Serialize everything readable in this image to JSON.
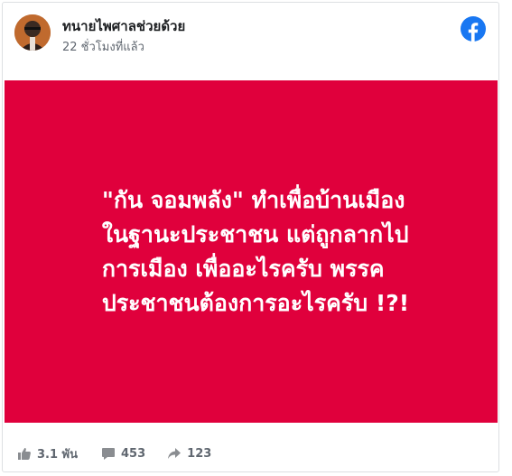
{
  "post": {
    "author": "ทนายไพศาลช่วยด้วย",
    "timestamp": "22 ชั่วโมงที่แล้ว",
    "image_text": {
      "line1": "\"กัน จอมพลัง\" ทำเพื่อบ้านเมือง",
      "line2": "ในฐานะประชาชน แต่ถูกลากไป",
      "line3": "การเมือง เพื่ออะไรครับ พรรค",
      "line4": "ประชาชนต้องการอะไรครับ !?!"
    },
    "image_bg_color": "#e0003c"
  },
  "stats": {
    "likes": "3.1 พัน",
    "comments": "453",
    "shares": "123"
  },
  "colors": {
    "facebook_blue": "#1877f2",
    "meta_gray": "#606770"
  },
  "icons": {
    "brand": "facebook-logo-icon",
    "like": "thumbs-up-icon",
    "comment": "comment-bubble-icon",
    "share": "share-arrow-icon"
  }
}
